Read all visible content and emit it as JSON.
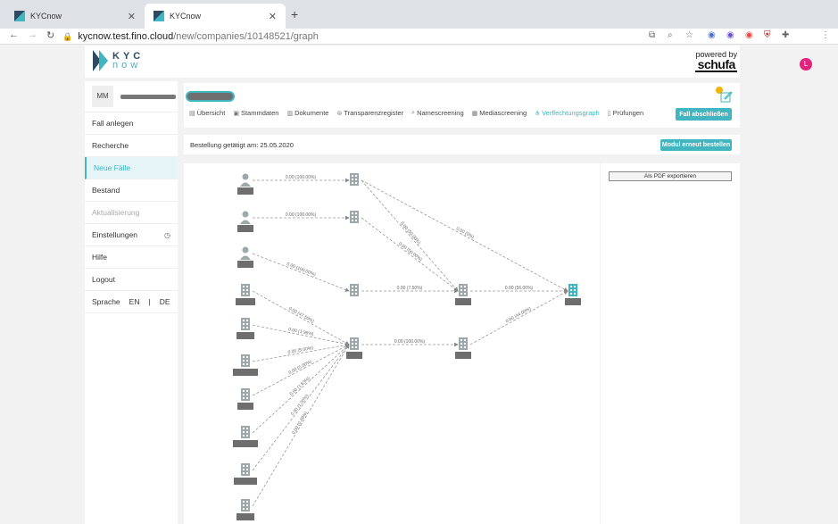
{
  "browser": {
    "tabs": [
      {
        "title": "KYCnow"
      },
      {
        "title": "KYCnow"
      }
    ],
    "url_host": "kycnow.test.fino.cloud",
    "url_path": "/new/companies/10148521/graph",
    "profile_initial": "L"
  },
  "header": {
    "logo_top": "KYC",
    "logo_bottom": "now",
    "powered_by": "powered by",
    "partner": "schufa"
  },
  "sidebar": {
    "initials": "MM",
    "items": [
      {
        "label": "Fall anlegen"
      },
      {
        "label": "Recherche"
      },
      {
        "label": "Neue Fälle"
      },
      {
        "label": "Bestand"
      },
      {
        "label": "Aktualisierung"
      },
      {
        "label": "Einstellungen"
      },
      {
        "label": "Hilfe"
      },
      {
        "label": "Logout"
      }
    ],
    "language_label": "Sprache",
    "lang_en": "EN",
    "lang_sep": "|",
    "lang_de": "DE"
  },
  "tabs": [
    {
      "label": "Übersicht"
    },
    {
      "label": "Stammdaten"
    },
    {
      "label": "Dokumente"
    },
    {
      "label": "Transparenzregister"
    },
    {
      "label": "Namescreening"
    },
    {
      "label": "Mediascreening"
    },
    {
      "label": "Verflechtungsgraph"
    },
    {
      "label": "Prüfungen"
    }
  ],
  "actions": {
    "close_case": "Fall abschließen",
    "reorder": "Modul erneut bestellen",
    "export_pdf": "Als PDF exportieren"
  },
  "order_info": "Bestellung getätigt am: 25.05.2020",
  "graph": {
    "edge_labels": [
      "0.00 (100.00%)",
      "0.00 (100.00%)",
      "0.00 (100.00%)",
      "0.00 (50.00%)",
      "0.00 (50.00%)",
      "0.00 (0%)",
      "0.00 (7.50%)",
      "0.00 (56.00%)",
      "0.00 (44.00%)",
      "0.00 (100.00%)",
      "0.00 (47.50%)",
      "0.00 (1.96%)",
      "0.00 (5.00%)",
      "0.00 (5.00%)",
      "0.00 (1.63%)",
      "0.00 (1.00%)",
      "0.00 (0.49%)"
    ]
  },
  "colors": {
    "accent": "#41b6c0",
    "navy": "#2e4a60",
    "mask": "#6e6e6e",
    "node": "#9ea7aa"
  }
}
